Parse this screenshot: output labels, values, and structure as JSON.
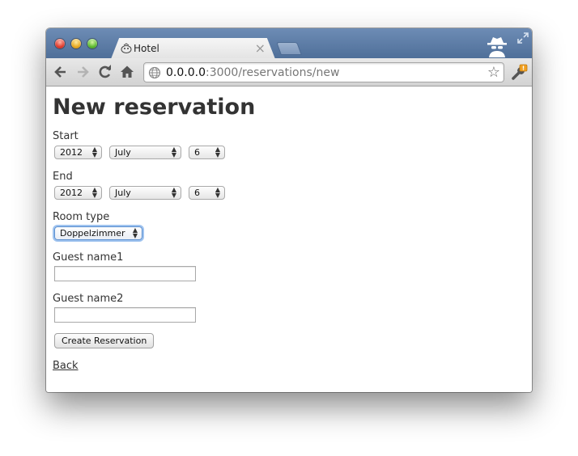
{
  "browser": {
    "tab_title": "Hotel",
    "tab_close": "×",
    "url_host": "0.0.0.0",
    "url_rest": ":3000/reservations/new",
    "star": "☆"
  },
  "page": {
    "title": "New reservation",
    "start_label": "Start",
    "start_year": "2012",
    "start_month": "July",
    "start_day": "6",
    "end_label": "End",
    "end_year": "2012",
    "end_month": "July",
    "end_day": "6",
    "room_type_label": "Room type",
    "room_type_value": "Doppelzimmer",
    "guest1_label": "Guest name1",
    "guest1_value": "",
    "guest2_label": "Guest name2",
    "guest2_value": "",
    "submit_label": "Create Reservation",
    "back_label": "Back"
  },
  "colors": {
    "titlebar": "#5b7aa4",
    "focus_ring": "#9fc3ef"
  },
  "icons": [
    "close-window-icon",
    "minimize-icon",
    "zoom-icon",
    "tab-favicon-icon",
    "tab-close-icon",
    "incognito-icon",
    "fullscreen-icon",
    "back-arrow-icon",
    "forward-arrow-icon",
    "reload-icon",
    "home-icon",
    "globe-icon",
    "bookmark-star-icon",
    "wrench-icon"
  ]
}
